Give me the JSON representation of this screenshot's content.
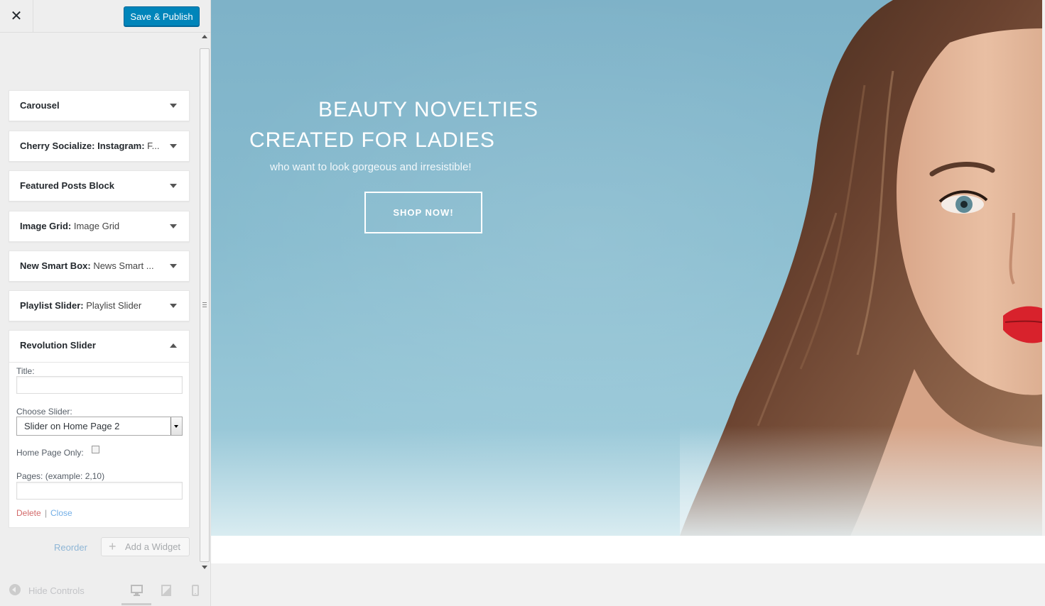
{
  "header": {
    "close_symbol": "✕",
    "publish_label": "Save & Publish"
  },
  "widgets": [
    {
      "title": "Carousel",
      "subtitle": ""
    },
    {
      "title": "Cherry Socialize: Instagram:",
      "subtitle": " F..."
    },
    {
      "title": "Featured Posts Block",
      "subtitle": ""
    },
    {
      "title": "Image Grid:",
      "subtitle": " Image Grid"
    },
    {
      "title": "New Smart Box:",
      "subtitle": " News Smart ..."
    },
    {
      "title": "Playlist Slider:",
      "subtitle": " Playlist Slider"
    }
  ],
  "revolution": {
    "title": "Revolution Slider",
    "title_label": "Title:",
    "title_value": "",
    "choose_label": "Choose Slider:",
    "selected_slider": "Slider on Home Page 2",
    "home_only_label": "Home Page Only:",
    "home_only_checked": false,
    "pages_label": "Pages: (example: 2,10)",
    "pages_value": "",
    "delete_label": "Delete",
    "separator": "|",
    "close_label": "Close"
  },
  "actions": {
    "reorder_label": "Reorder",
    "add_widget_label": "Add a Widget",
    "add_icon": "+"
  },
  "footer": {
    "hide_controls_label": "Hide Controls",
    "devices": [
      "desktop-icon",
      "tablet-icon",
      "mobile-icon"
    ]
  },
  "hero": {
    "line1": "BEAUTY NOVELTIES",
    "line2": "CREATED FOR LADIES",
    "subtitle": "who want to look gorgeous and irresistible!",
    "button_label": "SHOP NOW!"
  },
  "colors": {
    "primary_button": "#0085ba",
    "delete_link": "#d26a6a",
    "close_link": "#72aee6",
    "hero_background": "#88bccf"
  }
}
